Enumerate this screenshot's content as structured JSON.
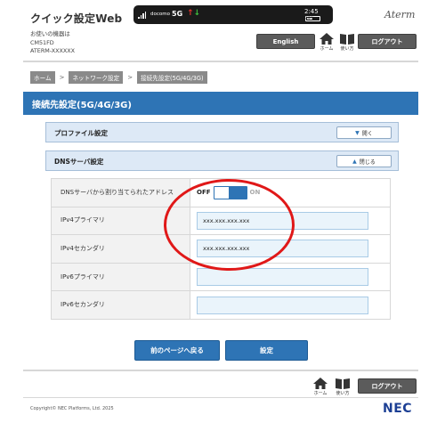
{
  "header": {
    "app_title": "クイック設定Web",
    "device_label": "お使いの機器は",
    "device_model": "CM51FD",
    "device_id": "ATERM-XXXXXX",
    "brand": "Aterm",
    "english_button": "English",
    "home_label": "ホーム",
    "manual_label": "使い方",
    "logout_button": "ログアウト"
  },
  "status_bar": {
    "carrier": "docomo",
    "network": "5G",
    "clock": "2:45",
    "battery": "49%"
  },
  "breadcrumb": [
    "ホーム",
    "ネットワーク設定",
    "接続先設定(5G/4G/3G)"
  ],
  "page_title": "接続先設定(5G/4G/3G)",
  "sections": {
    "profile": {
      "title": "プロファイル設定",
      "toggle_label": "開く"
    },
    "dns": {
      "title": "DNSサーバ設定",
      "toggle_label": "閉じる"
    }
  },
  "dns_form": {
    "auto_dns_label": "DNSサーバから割り当てられたアドレス",
    "toggle_off": "OFF",
    "toggle_on": "ON",
    "toggle_state": "OFF",
    "rows": [
      {
        "label": "IPv4プライマリ",
        "value": "xxx.xxx.xxx.xxx"
      },
      {
        "label": "IPv4セカンダリ",
        "value": "xxx.xxx.xxx.xxx"
      },
      {
        "label": "IPv6プライマリ",
        "value": ""
      },
      {
        "label": "IPv6セカンダリ",
        "value": ""
      }
    ]
  },
  "actions": {
    "back_button": "前のページへ戻る",
    "set_button": "設定"
  },
  "footer": {
    "home_label": "ホーム",
    "manual_label": "使い方",
    "logout_button": "ログアウト",
    "copyright": "Copyright© NEC Platforms, Ltd. 2025",
    "logo": "NEC"
  },
  "colors": {
    "accent": "#2e74b5",
    "section_bg": "#dde9f6",
    "annotation": "#e01818"
  }
}
